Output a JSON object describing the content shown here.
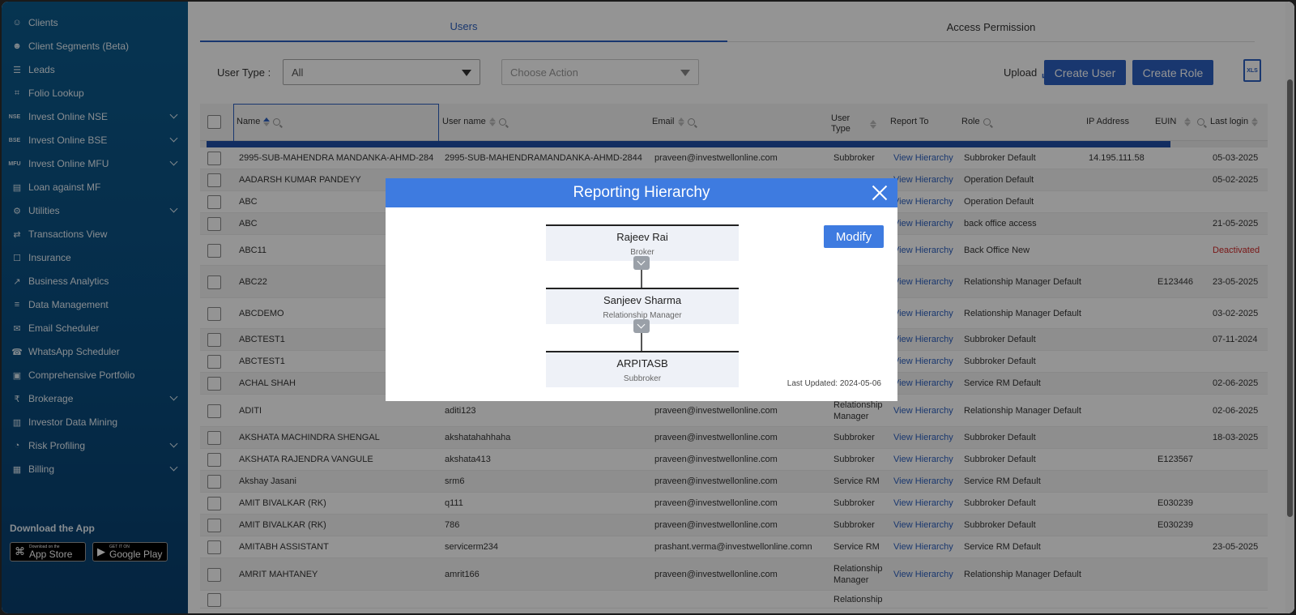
{
  "sidebar": {
    "items": [
      {
        "icon": "users-icon",
        "label": "Clients",
        "chev": false
      },
      {
        "icon": "segments-icon",
        "label": "Client Segments (Beta)",
        "chev": false
      },
      {
        "icon": "leads-icon",
        "label": "Leads",
        "chev": false
      },
      {
        "icon": "folio-icon",
        "label": "Folio Lookup",
        "chev": false
      },
      {
        "icon": "NSE",
        "label": "Invest Online NSE",
        "chev": true
      },
      {
        "icon": "BSE",
        "label": "Invest Online BSE",
        "chev": true
      },
      {
        "icon": "MFU",
        "label": "Invest Online MFU",
        "chev": true
      },
      {
        "icon": "loan-icon",
        "label": "Loan against MF",
        "chev": false
      },
      {
        "icon": "utilities-icon",
        "label": "Utilities",
        "chev": true
      },
      {
        "icon": "transactions-icon",
        "label": "Transactions View",
        "chev": false
      },
      {
        "icon": "insurance-icon",
        "label": "Insurance",
        "chev": false
      },
      {
        "icon": "analytics-icon",
        "label": "Business Analytics",
        "chev": false
      },
      {
        "icon": "data-icon",
        "label": "Data Management",
        "chev": false
      },
      {
        "icon": "email-icon",
        "label": "Email Scheduler",
        "chev": false
      },
      {
        "icon": "whatsapp-icon",
        "label": "WhatsApp Scheduler",
        "chev": false
      },
      {
        "icon": "portfolio-icon",
        "label": "Comprehensive Portfolio",
        "chev": false
      },
      {
        "icon": "brokerage-icon",
        "label": "Brokerage",
        "chev": true
      },
      {
        "icon": "mining-icon",
        "label": "Investor Data Mining",
        "chev": false
      },
      {
        "icon": "risk-icon",
        "label": "Risk Profiling",
        "chev": true
      },
      {
        "icon": "billing-icon",
        "label": "Billing",
        "chev": true
      }
    ],
    "download_title": "Download the App",
    "app_store_small": "Download on the",
    "app_store_big": "App Store",
    "google_play_small": "GET IT ON",
    "google_play_big": "Google Play"
  },
  "tabs": {
    "users": "Users",
    "access": "Access Permission"
  },
  "toolbar": {
    "user_type_label": "User Type :",
    "user_type_value": "All",
    "action_placeholder": "Choose Action",
    "upload_label": "Upload",
    "create_user": "Create User",
    "create_role": "Create Role",
    "xls_label": "XLS"
  },
  "table": {
    "headers": {
      "name": "Name",
      "username": "User name",
      "email": "Email",
      "user_type": "User Type",
      "report_to": "Report To",
      "role": "Role",
      "ip": "IP Address",
      "euin": "EUIN",
      "last_login": "Last login"
    },
    "rows": [
      {
        "name": "2995-SUB-MAHENDRA MANDANKA-AHMD-284",
        "username": "2995-SUB-MAHENDRAMANDANKA-AHMD-2844",
        "email": "praveen@investwellonline.com",
        "type": "Subbroker",
        "report": "View Hierarchy",
        "role": "Subbroker Default",
        "ip": "14.195.111.58",
        "euin": "",
        "last": "05-03-2025"
      },
      {
        "name": "AADARSH KUMAR PANDEYY",
        "username": "",
        "email": "",
        "type": "",
        "report": "View Hierarchy",
        "role": "Operation Default",
        "ip": "",
        "euin": "",
        "last": "05-02-2025"
      },
      {
        "name": "ABC",
        "username": "",
        "email": "",
        "type": "",
        "report": "View Hierarchy",
        "role": "Operation Default",
        "ip": "",
        "euin": "",
        "last": ""
      },
      {
        "name": "ABC",
        "username": "",
        "email": "",
        "type": "",
        "report": "View Hierarchy",
        "role": "back office access",
        "ip": "",
        "euin": "",
        "last": "21-05-2025"
      },
      {
        "name": "ABC11",
        "username": "",
        "email": "",
        "type": "",
        "report": "View Hierarchy",
        "role": "Back Office New",
        "ip": "",
        "euin": "",
        "last": "Deactivated"
      },
      {
        "name": "ABC22",
        "username": "",
        "email": "",
        "type": "",
        "report": "View Hierarchy",
        "role": "Relationship Manager Default",
        "ip": "",
        "euin": "E123446",
        "last": "23-05-2025"
      },
      {
        "name": "ABCDEMO",
        "username": "",
        "email": "",
        "type": "",
        "report": "View Hierarchy",
        "role": "Relationship Manager Default",
        "ip": "",
        "euin": "",
        "last": "03-02-2025"
      },
      {
        "name": "ABCTEST1",
        "username": "",
        "email": "",
        "type": "",
        "report": "View Hierarchy",
        "role": "Subbroker Default",
        "ip": "",
        "euin": "",
        "last": "07-11-2024"
      },
      {
        "name": "ABCTEST1",
        "username": "",
        "email": "",
        "type": "",
        "report": "View Hierarchy",
        "role": "Subbroker Default",
        "ip": "",
        "euin": "",
        "last": ""
      },
      {
        "name": "ACHAL SHAH",
        "username": "",
        "email": "",
        "type": "",
        "report": "View Hierarchy",
        "role": "Service RM Default",
        "ip": "",
        "euin": "",
        "last": "02-06-2025"
      },
      {
        "name": "ADITI",
        "username": "aditi123",
        "email": "praveen@investwellonline.com",
        "type": "Relationship Manager",
        "report": "View Hierarchy",
        "role": "Relationship Manager Default",
        "ip": "",
        "euin": "",
        "last": "02-06-2025"
      },
      {
        "name": "AKSHATA MACHINDRA SHENGAL",
        "username": "akshatahahhaha",
        "email": "praveen@investwellonline.com",
        "type": "Subbroker",
        "report": "View Hierarchy",
        "role": "Subbroker Default",
        "ip": "",
        "euin": "",
        "last": "18-03-2025"
      },
      {
        "name": "AKSHATA RAJENDRA VANGULE",
        "username": "akshata413",
        "email": "praveen@investwellonline.com",
        "type": "Subbroker",
        "report": "View Hierarchy",
        "role": "Subbroker Default",
        "ip": "",
        "euin": "E123567",
        "last": ""
      },
      {
        "name": "Akshay Jasani",
        "username": "srm6",
        "email": "praveen@investwellonline.com",
        "type": "Service RM",
        "report": "View Hierarchy",
        "role": "Service RM Default",
        "ip": "",
        "euin": "",
        "last": ""
      },
      {
        "name": "AMIT BIVALKAR (RK)",
        "username": "q111",
        "email": "praveen@investwellonline.com",
        "type": "Subbroker",
        "report": "View Hierarchy",
        "role": "Subbroker Default",
        "ip": "",
        "euin": "E030239",
        "last": ""
      },
      {
        "name": "AMIT BIVALKAR (RK)",
        "username": "786",
        "email": "praveen@investwellonline.com",
        "type": "Subbroker",
        "report": "View Hierarchy",
        "role": "Subbroker Default",
        "ip": "",
        "euin": "E030239",
        "last": ""
      },
      {
        "name": "AMITABH ASSISTANT",
        "username": "servicerm234",
        "email": "prashant.verma@investwellonline.comn",
        "type": "Service RM",
        "report": "View Hierarchy",
        "role": "Service RM Default",
        "ip": "",
        "euin": "",
        "last": "23-05-2025"
      },
      {
        "name": "AMRIT MAHTANEY",
        "username": "amrit166",
        "email": "praveen@investwellonline.com",
        "type": "Relationship Manager",
        "report": "View Hierarchy",
        "role": "Relationship Manager Default",
        "ip": "",
        "euin": "",
        "last": ""
      },
      {
        "name": "",
        "username": "",
        "email": "",
        "type": "Relationship",
        "report": "",
        "role": "",
        "ip": "",
        "euin": "",
        "last": ""
      }
    ]
  },
  "modal": {
    "title": "Reporting Hierarchy",
    "modify": "Modify",
    "last_updated": "Last Updated: 2024-05-06",
    "nodes": [
      {
        "name": "Rajeev Rai",
        "role": "Broker"
      },
      {
        "name": "Sanjeev Sharma",
        "role": "Relationship Manager"
      },
      {
        "name": "ARPITASB",
        "role": "Subbroker"
      }
    ]
  },
  "colors": {
    "accent": "#2b5fbf",
    "modal_header": "#3e7be0",
    "sidebar": "#0c5a8c",
    "deactivated": "#d02a2a"
  }
}
